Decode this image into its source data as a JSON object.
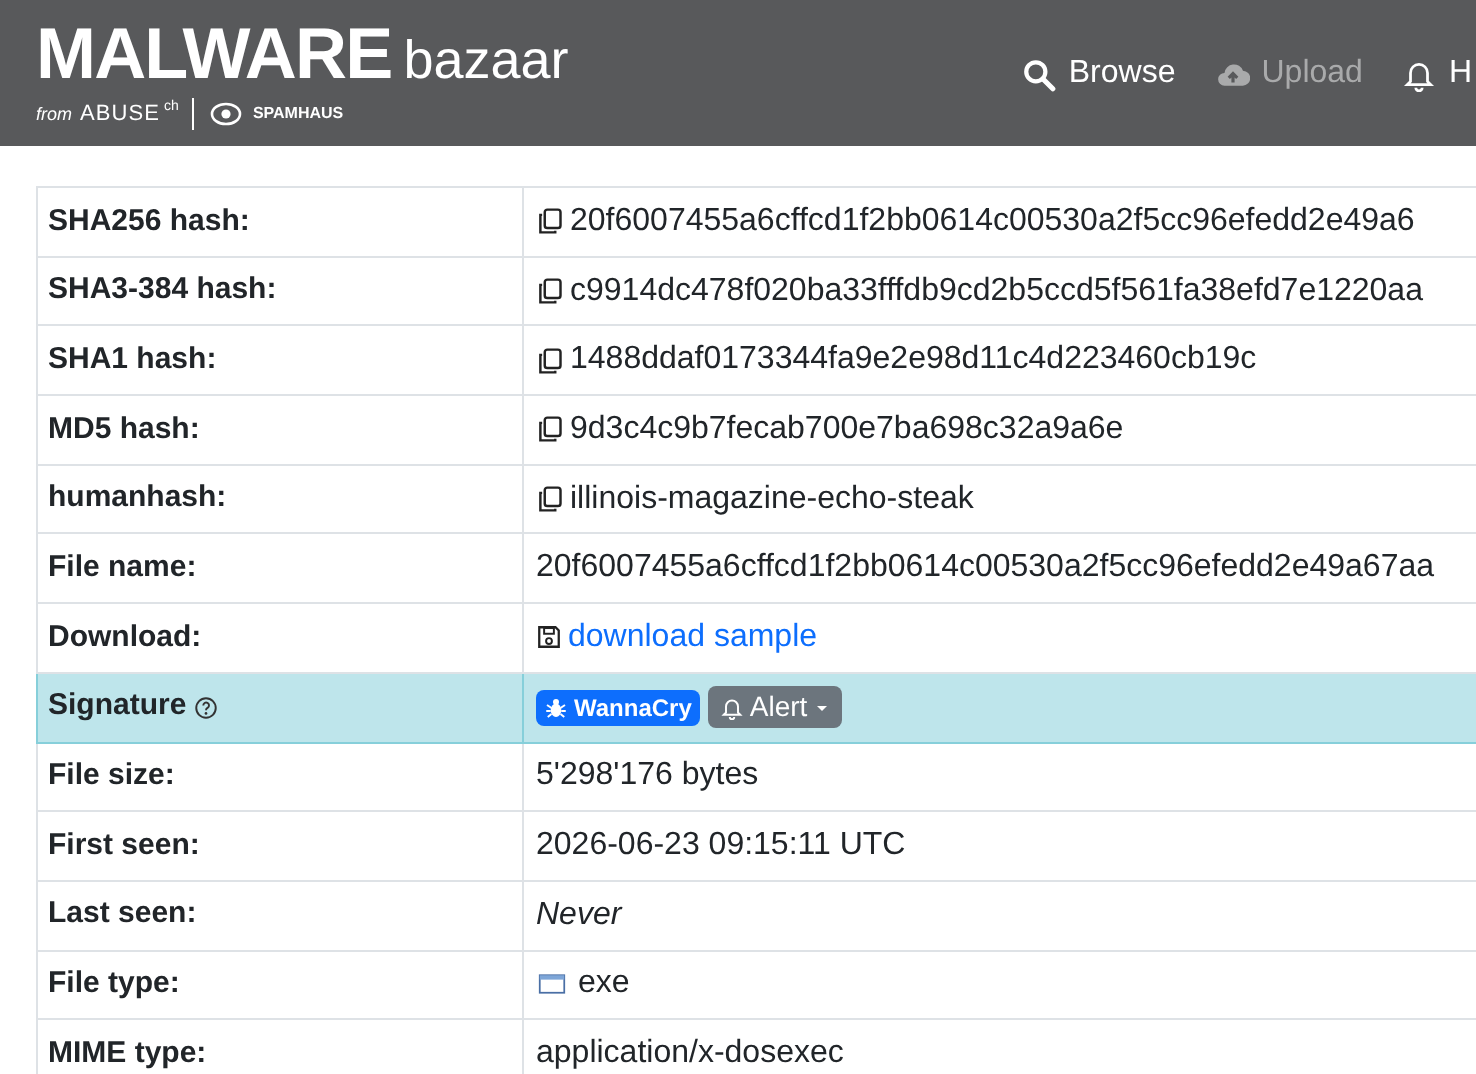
{
  "header": {
    "logo": {
      "title": "MALWARE",
      "subtitle": "bazaar",
      "from": "from",
      "abuse": "ABUSE",
      "abuse_suffix": "ch",
      "partner": "SPAMHAUS"
    },
    "nav": [
      {
        "label": "Browse",
        "disabled": false
      },
      {
        "label": "Upload",
        "disabled": true
      },
      {
        "label": "H",
        "disabled": false
      }
    ]
  },
  "rows": [
    {
      "label": "SHA256 hash:",
      "kind": "copy",
      "value": "20f6007455a6cffcd1f2bb0614c00530a2f5cc96efedd2e49a6",
      "highlighted": false
    },
    {
      "label": "SHA3-384 hash:",
      "kind": "copy",
      "value": "c9914dc478f020ba33fffdb9cd2b5ccd5f561fa38efd7e1220aa",
      "highlighted": false
    },
    {
      "label": "SHA1 hash:",
      "kind": "copy",
      "value": "1488ddaf0173344fa9e2e98d11c4d223460cb19c",
      "highlighted": false
    },
    {
      "label": "MD5 hash:",
      "kind": "copy",
      "value": "9d3c4c9b7fecab700e7ba698c32a9a6e",
      "highlighted": false
    },
    {
      "label": "humanhash:",
      "kind": "copy",
      "value": "illinois-magazine-echo-steak",
      "highlighted": false
    },
    {
      "label": "File name:",
      "kind": "text",
      "value": "20f6007455a6cffcd1f2bb0614c00530a2f5cc96efedd2e49a67aa",
      "highlighted": false
    },
    {
      "label": "Download:",
      "kind": "link",
      "value": "download sample",
      "highlighted": false
    },
    {
      "label": "Signature",
      "kind": "signature",
      "signature": "WannaCry",
      "alert": "Alert",
      "highlighted": true
    },
    {
      "label": "File size:",
      "kind": "text",
      "value": "5'298'176 bytes",
      "highlighted": false
    },
    {
      "label": "First seen:",
      "kind": "text",
      "value": "2026-06-23 09:15:11 UTC",
      "highlighted": false
    },
    {
      "label": "Last seen:",
      "kind": "italic",
      "value": "Never",
      "highlighted": false
    },
    {
      "label": "File type:",
      "kind": "filetype",
      "value": "exe",
      "highlighted": false
    },
    {
      "label": "MIME type:",
      "kind": "text",
      "value": "application/x-dosexec",
      "highlighted": false
    }
  ]
}
